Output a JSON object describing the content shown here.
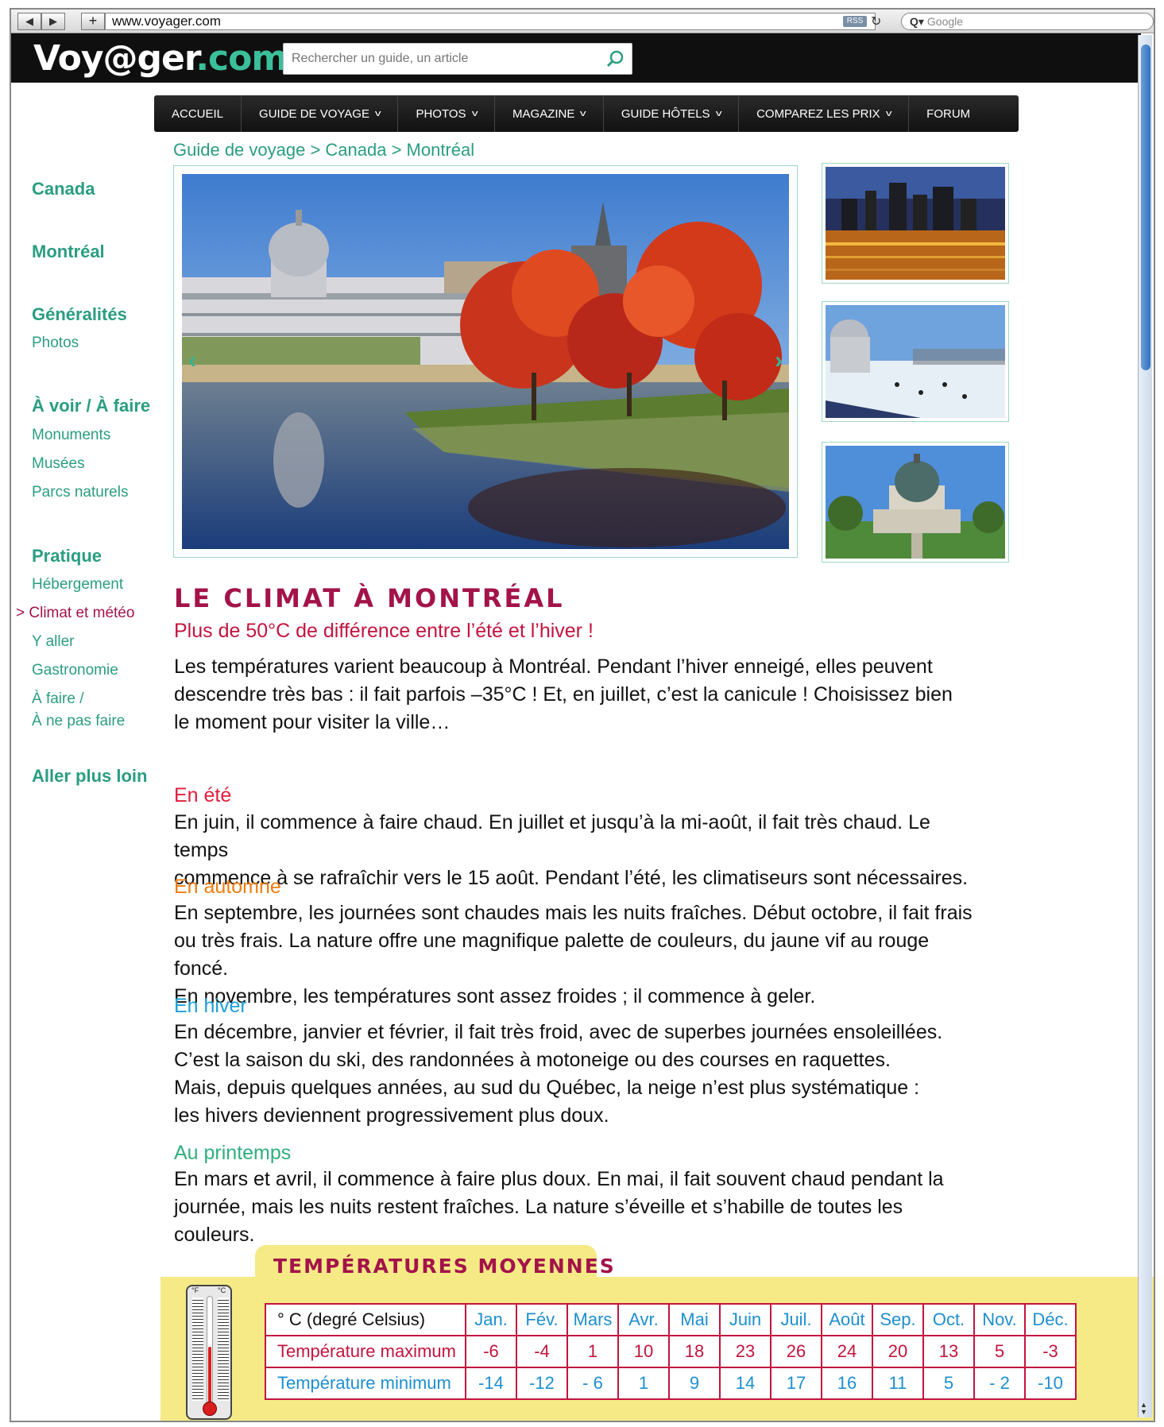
{
  "browser": {
    "url": "www.voyager.com",
    "rss_label": "RSS",
    "search_engine_placeholder": "Google"
  },
  "header": {
    "logo_part1": "Voy@ger",
    "logo_part2": ".com",
    "search_placeholder": "Rechercher un guide, un article"
  },
  "nav": {
    "items": [
      {
        "label": "ACCUEIL",
        "has_dropdown": false
      },
      {
        "label": "GUIDE DE VOYAGE",
        "has_dropdown": true
      },
      {
        "label": "PHOTOS",
        "has_dropdown": true
      },
      {
        "label": "MAGAZINE",
        "has_dropdown": true
      },
      {
        "label": "GUIDE HÔTELS",
        "has_dropdown": true
      },
      {
        "label": "COMPAREZ LES PRIX",
        "has_dropdown": true
      },
      {
        "label": "FORUM",
        "has_dropdown": false
      }
    ]
  },
  "breadcrumb": "Guide de voyage > Canada > Montréal",
  "sidebar": {
    "canada": "Canada",
    "montreal": "Montréal",
    "generalites": "Généralités",
    "photos": "Photos",
    "a_voir": "À voir / À faire",
    "monuments": "Monuments",
    "musees": "Musées",
    "parcs": "Parcs naturels",
    "pratique": "Pratique",
    "hebergement": "Hébergement",
    "climat": "> Climat et météo",
    "y_aller": "Y aller",
    "gastronomie": "Gastronomie",
    "a_faire_1": "À faire /",
    "a_faire_2": "À ne pas faire",
    "aller_plus_loin": "Aller plus loin"
  },
  "article": {
    "title": "LE CLIMAT À MONTRÉAL",
    "subtitle": "Plus de 50°C de différence entre l’été et l’hiver !",
    "intro_lines": [
      "Les températures varient beaucoup à Montréal. Pendant l’hiver enneigé, elles peuvent",
      "descendre très bas : il fait parfois –35°C ! Et, en juillet, c’est la canicule ! Choisissez bien",
      "le moment pour visiter la ville…"
    ],
    "seasons": {
      "ete": {
        "heading": "En été",
        "color": "#e01e3c",
        "lines": [
          "En juin, il commence à faire chaud. En juillet et jusqu’à la mi-août, il fait très chaud. Le temps",
          "commence à se rafraîchir vers le 15 août. Pendant l’été, les climatiseurs sont nécessaires."
        ]
      },
      "automne": {
        "heading": "En automne",
        "color": "#ef7d10",
        "lines": [
          "En septembre, les journées sont chaudes mais les nuits fraîches. Début octobre, il fait frais",
          "ou très frais. La nature offre une magnifique palette de couleurs, du jaune vif au rouge foncé.",
          "En novembre, les températures sont assez froides ; il commence à geler."
        ]
      },
      "hiver": {
        "heading": "En hiver",
        "color": "#1d9fd8",
        "lines": [
          "En décembre, janvier et février, il fait très froid, avec de superbes journées ensoleillées.",
          "C’est la saison du ski, des randonnées à motoneige ou des courses en raquettes.",
          "Mais, depuis quelques années, au sud du Québec, la neige n’est plus systématique :",
          "les hivers deviennent progressivement plus doux."
        ]
      },
      "printemps": {
        "heading": "Au printemps",
        "color": "#2fae7f",
        "lines": [
          "En mars et avril, il commence à faire plus doux. En mai, il fait souvent chaud pendant la",
          "journée, mais les nuits restent fraîches. La nature s’éveille et s’habille de toutes les couleurs."
        ]
      }
    }
  },
  "temperatures": {
    "title": "TEMPÉRATURES MOYENNES",
    "thermo_f": "°F",
    "thermo_c": "°C",
    "unit_label": "° C (degré Celsius)",
    "months": [
      "Jan.",
      "Fév.",
      "Mars",
      "Avr.",
      "Mai",
      "Juin",
      "Juil.",
      "Août",
      "Sep.",
      "Oct.",
      "Nov.",
      "Déc."
    ],
    "max_label": "Température maximum",
    "max_values": [
      "-6",
      "-4",
      "1",
      "10",
      "18",
      "23",
      "26",
      "24",
      "20",
      "13",
      "5",
      "-3"
    ],
    "min_label": "Température minimum",
    "min_values": [
      "-14",
      "-12",
      "- 6",
      "1",
      "9",
      "14",
      "17",
      "16",
      "11",
      "5",
      "- 2",
      "-10"
    ]
  },
  "colors": {
    "brand_green": "#2a9d82",
    "accent_red": "#a3134a",
    "panel_yellow": "#f6ea86"
  }
}
